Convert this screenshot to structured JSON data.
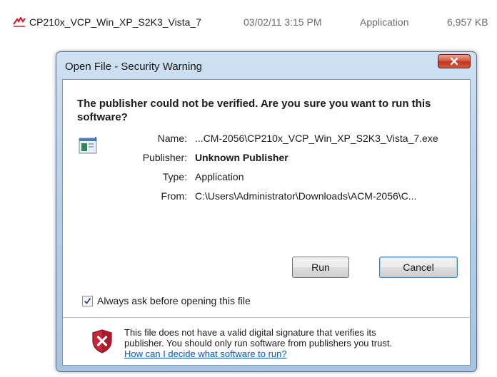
{
  "file_row": {
    "name": "CP210x_VCP_Win_XP_S2K3_Vista_7",
    "date": "03/02/11 3:15 PM",
    "type": "Application",
    "size": "6,957 KB"
  },
  "dialog": {
    "title": "Open File - Security Warning",
    "heading": "The publisher could not be verified.  Are you sure you want to run this software?",
    "details": [
      {
        "label": "Name:",
        "value": "...CM-2056\\CP210x_VCP_Win_XP_S2K3_Vista_7.exe"
      },
      {
        "label": "Publisher:",
        "value": "Unknown Publisher"
      },
      {
        "label": "Type:",
        "value": "Application"
      },
      {
        "label": "From:",
        "value": "C:\\Users\\Administrator\\Downloads\\ACM-2056\\C..."
      }
    ],
    "run_label": "Run",
    "cancel_label": "Cancel",
    "always_ask_label": "Always ask before opening this file",
    "always_ask_checked": true,
    "warning_line1": "This file does not have a valid digital signature that verifies its",
    "warning_line2": "publisher.  You should only run software from publishers you trust.",
    "help_link": "How can I decide what software to run?"
  },
  "colors": {
    "link": "#0f52b5",
    "close_button": "#c0341d",
    "frame": "#b9d1ea"
  },
  "icons": [
    "application-file-icon",
    "close-icon",
    "application-icon",
    "checkmark-icon",
    "security-shield-icon"
  ]
}
